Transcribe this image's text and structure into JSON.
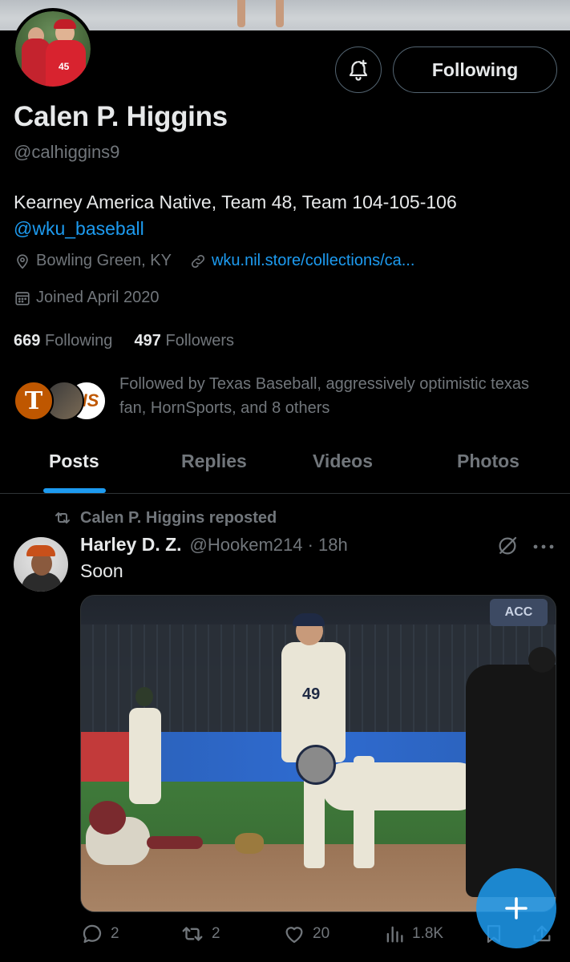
{
  "profile": {
    "name": "Calen P. Higgins",
    "handle": "@calhiggins9",
    "avatar_number": "45",
    "bio_text": "Kearney America Native, Team 48, Team 104-105-106",
    "bio_link": "@wku_baseball",
    "location": "Bowling Green, KY",
    "website": "wku.nil.store/collections/ca...",
    "joined": "Joined April 2020",
    "following_count": "669",
    "following_label": "Following",
    "followers_count": "497",
    "followers_label": "Followers",
    "followed_by": "Followed by Texas Baseball, aggressively optimistic texas fan, HornSports, and 8 others",
    "follower_avatars": [
      "T",
      "",
      "HS"
    ]
  },
  "actions": {
    "notify_icon": "bell-plus-icon",
    "follow_button": "Following"
  },
  "tabs": [
    {
      "label": "Posts",
      "active": true
    },
    {
      "label": "Replies",
      "active": false
    },
    {
      "label": "Videos",
      "active": false
    },
    {
      "label": "Photos",
      "active": false
    }
  ],
  "post": {
    "repost_label": "Calen P. Higgins reposted",
    "author_name": "Harley D. Z.",
    "author_meta": "@Hookem214 · 18h",
    "text": "Soon",
    "media_sign": "ACC",
    "jersey_number": "49",
    "stats": {
      "replies": "2",
      "reposts": "2",
      "likes": "20",
      "views": "1.8K"
    }
  },
  "colors": {
    "background": "#000000",
    "text": "#e7e9ea",
    "muted": "#71767b",
    "accent": "#1d9bf0",
    "border": "#2f3336"
  }
}
